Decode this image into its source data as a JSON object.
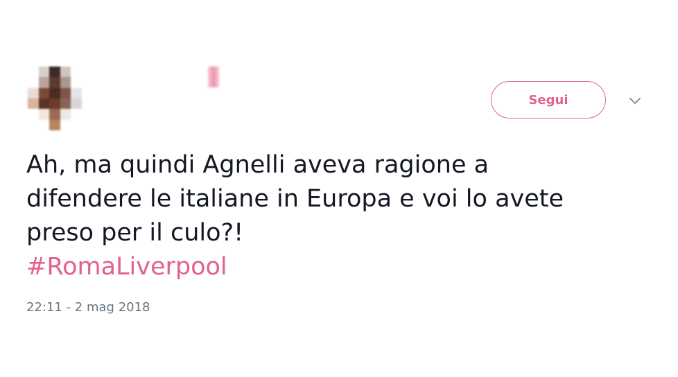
{
  "tweet": {
    "text_lines": [
      "Ah, ma quindi Agnelli aveva ragione a",
      "difendere le italiane in Europa e voi lo avete",
      "preso per il culo?!"
    ],
    "hashtag": "#RomaLiverpool",
    "timestamp": "22:11 - 2 mag 2018"
  },
  "header": {
    "follow_label": "Segui",
    "menu_icon": "chevron-down-icon"
  },
  "colors": {
    "accent": "#e2628c",
    "text": "#141823",
    "muted": "#667580"
  }
}
